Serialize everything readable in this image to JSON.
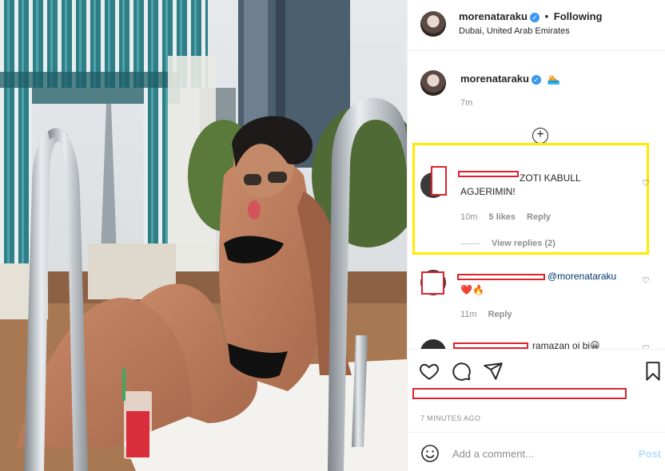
{
  "post": {
    "author": "morenataraku",
    "follow_label": "Following",
    "separator": "•",
    "location": "Dubai, United Arab Emirates"
  },
  "caption": {
    "author": "morenataraku",
    "emoji": "🏊",
    "time": "7m"
  },
  "comments": [
    {
      "text": "ZOTI KABULL AGJERIMIN!",
      "time": "10m",
      "likes": "5 likes",
      "reply": "Reply",
      "view_replies": "View replies (2)"
    },
    {
      "mention": "@morenataraku",
      "emoji": "❤️🔥",
      "time": "11m",
      "reply": "Reply"
    },
    {
      "text": "ramazan oj bi😀"
    }
  ],
  "actions": {
    "posted_time": "7 MINUTES AGO"
  },
  "add_comment": {
    "placeholder": "Add a comment...",
    "post_label": "Post"
  },
  "colors": {
    "verified": "#3897f0",
    "redaction": "#e0212b",
    "highlight": "#ffea00",
    "post_disabled": "#b2dffc"
  }
}
